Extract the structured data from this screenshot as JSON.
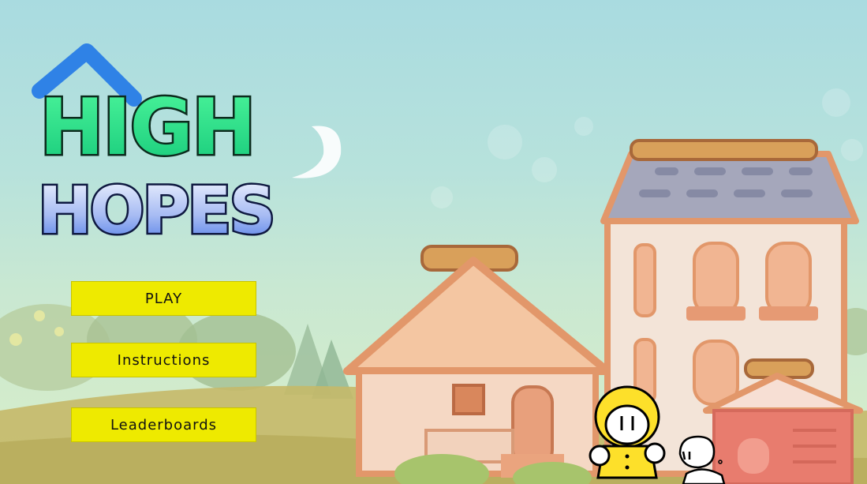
{
  "game": {
    "title_line1": "HIGH",
    "title_line2": "HOPES"
  },
  "menu": {
    "play_label": "PLAY",
    "instructions_label": "Instructions",
    "leaderboards_label": "Leaderboards"
  },
  "colors": {
    "button_bg": "#eeea00",
    "title_green": "#2ee88a",
    "title_blue": "#6f8ff0",
    "character_yellow": "#fde02a"
  }
}
